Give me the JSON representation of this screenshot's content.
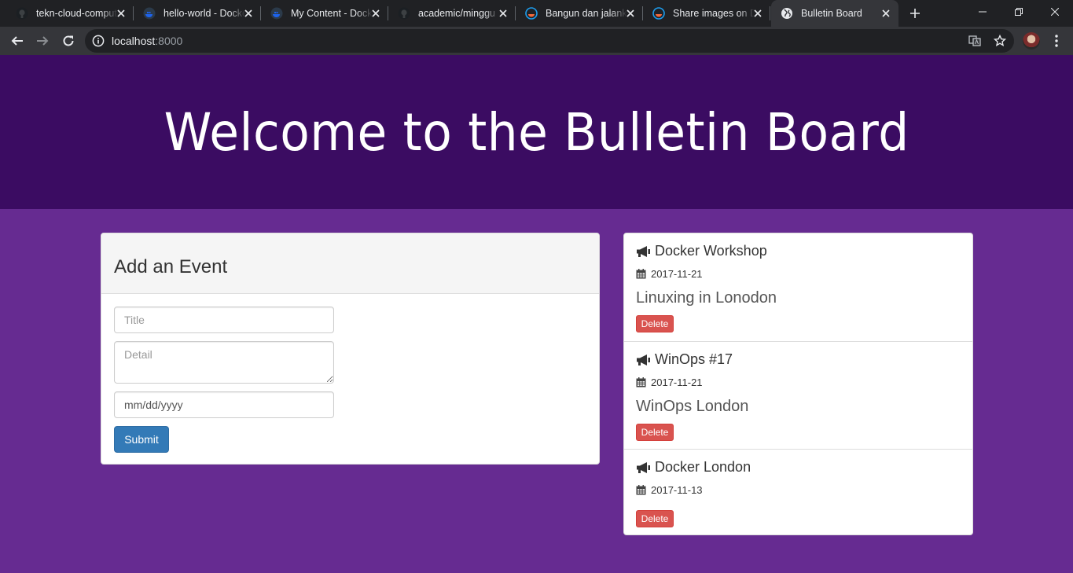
{
  "browser": {
    "tabs": [
      {
        "title": "tekn-cloud-computing",
        "icon": "github-icon",
        "active": false
      },
      {
        "title": "hello-world - Docker Hub",
        "icon": "docker-icon",
        "active": false
      },
      {
        "title": "My Content - Docker Hub",
        "icon": "docker-icon",
        "active": false
      },
      {
        "title": "academic/minggu",
        "icon": "github-icon",
        "active": false
      },
      {
        "title": "Bangun dan jalankan",
        "icon": "docker-icon",
        "active": false
      },
      {
        "title": "Share images on Docker",
        "icon": "docker-icon",
        "active": false
      },
      {
        "title": "Bulletin Board",
        "icon": "globe-icon",
        "active": true
      }
    ],
    "address": {
      "host": "localhost",
      "port": ":8000"
    },
    "colors": {
      "tabstrip": "#202124",
      "toolbar": "#35363a"
    }
  },
  "page": {
    "heading": "Welcome to the Bulletin Board",
    "colors": {
      "header": "#3b0c62",
      "background": "#662b91",
      "primary": "#337ab7",
      "danger": "#d9534f"
    },
    "form": {
      "panel_title": "Add an Event",
      "title_placeholder": "Title",
      "detail_placeholder": "Detail",
      "date_placeholder": "mm/dd/yyyy",
      "submit_label": "Submit"
    },
    "events": [
      {
        "title": "Docker Workshop",
        "date": "2017-11-21",
        "detail": "Linuxing in Lonodon",
        "delete_label": "Delete"
      },
      {
        "title": "WinOps #17",
        "date": "2017-11-21",
        "detail": "WinOps London",
        "delete_label": "Delete"
      },
      {
        "title": "Docker London",
        "date": "2017-11-13",
        "detail": "",
        "delete_label": "Delete"
      }
    ]
  }
}
